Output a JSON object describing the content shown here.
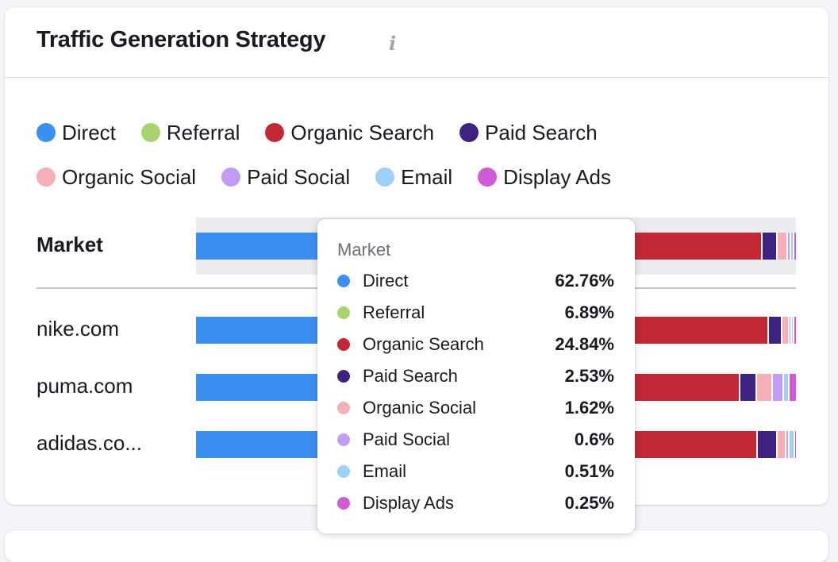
{
  "widget": {
    "title": "Traffic Generation Strategy",
    "info_icon": "info-icon"
  },
  "legend": [
    {
      "label": "Direct",
      "color": "#3b8ff0"
    },
    {
      "label": "Referral",
      "color": "#a8d46f"
    },
    {
      "label": "Organic Search",
      "color": "#c22836"
    },
    {
      "label": "Paid Search",
      "color": "#3d2281"
    },
    {
      "label": "Organic Social",
      "color": "#f4b0b6"
    },
    {
      "label": "Paid Social",
      "color": "#c09cf6"
    },
    {
      "label": "Email",
      "color": "#9fcffb"
    },
    {
      "label": "Display Ads",
      "color": "#d05bd8"
    }
  ],
  "chart_data": {
    "type": "bar",
    "stacked": true,
    "orientation": "horizontal",
    "title": "Traffic Generation Strategy",
    "unit": "%",
    "categories": [
      "Market",
      "nike.com",
      "puma.com",
      "adidas.co..."
    ],
    "series": [
      {
        "name": "Direct",
        "values": [
          62.76,
          63.0,
          58.5,
          61.0
        ]
      },
      {
        "name": "Referral",
        "values": [
          6.89,
          7.0,
          6.5,
          7.0
        ]
      },
      {
        "name": "Organic Search",
        "values": [
          24.84,
          25.5,
          25.1,
          25.0
        ]
      },
      {
        "name": "Paid Search",
        "values": [
          2.53,
          2.3,
          2.8,
          3.3
        ]
      },
      {
        "name": "Organic Social",
        "values": [
          1.62,
          1.2,
          2.6,
          1.4
        ]
      },
      {
        "name": "Paid Social",
        "values": [
          0.6,
          0.4,
          1.8,
          0.5
        ]
      },
      {
        "name": "Email",
        "values": [
          0.51,
          0.4,
          1.0,
          1.0
        ]
      },
      {
        "name": "Display Ads",
        "values": [
          0.25,
          0.2,
          1.0,
          0.1
        ]
      }
    ],
    "xlim": [
      0,
      100
    ],
    "legend_position": "top-left",
    "highlighted_category": "Market"
  },
  "tooltip": {
    "title": "Market",
    "rows": [
      {
        "label": "Direct",
        "value": "62.76%"
      },
      {
        "label": "Referral",
        "value": "6.89%"
      },
      {
        "label": "Organic Search",
        "value": "24.84%"
      },
      {
        "label": "Paid Search",
        "value": "2.53%"
      },
      {
        "label": "Organic Social",
        "value": "1.62%"
      },
      {
        "label": "Paid Social",
        "value": "0.6%"
      },
      {
        "label": "Email",
        "value": "0.51%"
      },
      {
        "label": "Display Ads",
        "value": "0.25%"
      }
    ]
  }
}
